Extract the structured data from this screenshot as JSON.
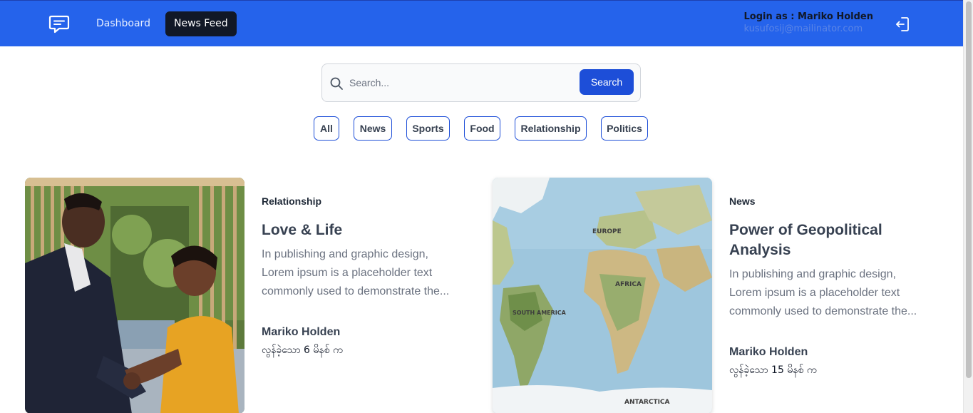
{
  "nav": {
    "logo_icon": "chat-bubble-icon",
    "dashboard_label": "Dashboard",
    "newsfeed_label": "News Feed",
    "user_label": "Login as : Mariko Holden",
    "user_email": "kusufosij@mailinator.com",
    "logout_icon": "logout-icon"
  },
  "search": {
    "placeholder": "Search...",
    "button_label": "Search",
    "icon": "search-icon"
  },
  "categories": [
    "All",
    "News",
    "Sports",
    "Food",
    "Relationship",
    "Politics"
  ],
  "posts": [
    {
      "category": "Relationship",
      "title": "Love & Life",
      "description": "In publishing and graphic design, Lorem ipsum is a placeholder text commonly used to demonstrate the...",
      "author": "Mariko Holden",
      "time": "လွန်ခဲ့သော 6 မိနစ် က"
    },
    {
      "category": "News",
      "title": "Power of Geopolitical Analysis",
      "description": "In publishing and graphic design, Lorem ipsum is a placeholder text commonly used to demonstrate the...",
      "author": "Mariko Holden",
      "time": "လွန်ခဲ့သော 15 မိနစ် က",
      "map_labels": [
        "EUROPE",
        "AFRICA",
        "SOUTH AMERICA",
        "ANTARCTICA"
      ]
    }
  ],
  "colors": {
    "header_bg": "#2563eb",
    "active_nav": "#111827",
    "button_blue": "#1d4ed8"
  }
}
